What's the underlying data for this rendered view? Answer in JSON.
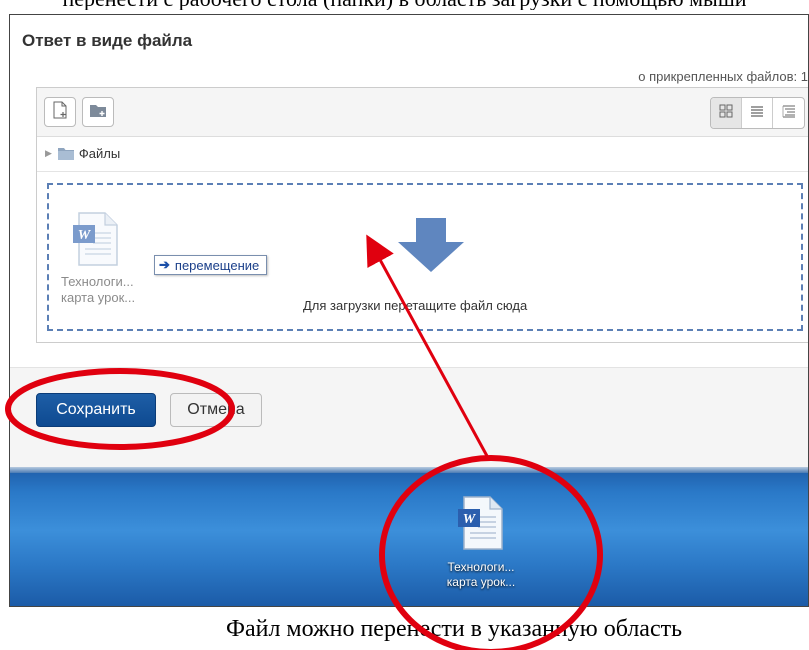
{
  "page": {
    "top_partial_text": "перенести с рабочего стола (папки) в область загрузки с помощью мыши",
    "bottom_partial_text": "Файл можно перенести в указанную область"
  },
  "form": {
    "title": "Ответ в виде файла",
    "attach_info": "о прикрепленных файлов: 1",
    "path_label": "Файлы",
    "dropzone_text": "Для загрузки перетащите файл сюда",
    "ghost_file_label_1": "Технологи...",
    "ghost_file_label_2": "карта урок...",
    "move_tooltip": "перемещение",
    "save_label": "Сохранить",
    "cancel_label": "Отмена"
  },
  "desktop": {
    "file_label_1": "Технологи...",
    "file_label_2": "карта урок..."
  },
  "icons": {
    "add_file": "add-file-icon",
    "create_folder": "create-folder-icon",
    "view_icons": "grid-view-icon",
    "view_list": "list-view-icon",
    "view_tree": "tree-view-icon",
    "folder": "folder-icon",
    "word_doc": "word-document-icon",
    "drop_arrow": "down-arrow-icon"
  },
  "colors": {
    "save_button": "#0e4a91",
    "dropzone_border": "#5b7fb5",
    "annotation_red": "#e0000f",
    "desktop_blue": "#2a79c8"
  }
}
